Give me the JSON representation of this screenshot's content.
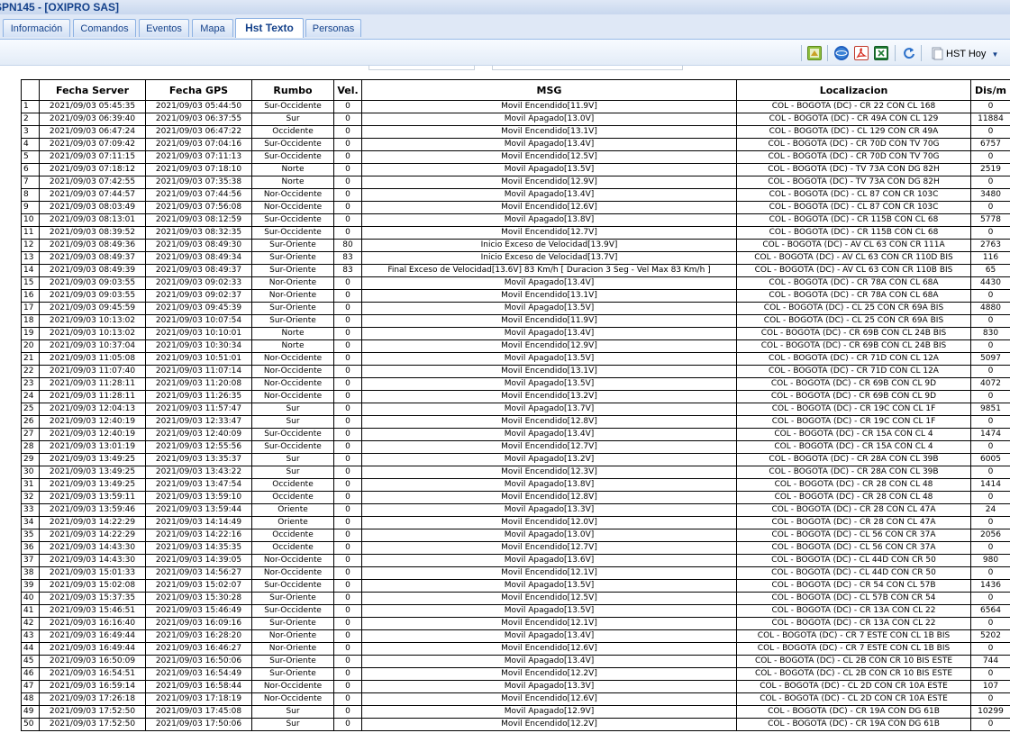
{
  "window": {
    "title": "SPN145 - [OXIPRO SAS]"
  },
  "tabs": [
    {
      "label": "Información",
      "active": false
    },
    {
      "label": "Comandos",
      "active": false
    },
    {
      "label": "Eventos",
      "active": false
    },
    {
      "label": "Mapa",
      "active": false
    },
    {
      "label": "Hst Texto",
      "active": true
    },
    {
      "label": "Personas",
      "active": false
    }
  ],
  "toolbar": {
    "icons": [
      "map-export-icon",
      "globe-icon",
      "pdf-icon",
      "excel-icon",
      "refresh-icon",
      "document-icon"
    ],
    "hst_label": "HST Hoy",
    "hst_dropdown_icon": "chevron-down-icon"
  },
  "table": {
    "columns": [
      "",
      "Fecha Server",
      "Fecha GPS",
      "Rumbo",
      "Vel.",
      "MSG",
      "Localizacion",
      "Dis/m"
    ],
    "rows": [
      [
        "1",
        "2021/09/03 05:45:35",
        "2021/09/03 05:44:50",
        "Sur-Occidente",
        "0",
        "Movil Encendido[11.9V]",
        "COL - BOGOTA (DC) - CR 22 CON CL 168",
        "0"
      ],
      [
        "2",
        "2021/09/03 06:39:40",
        "2021/09/03 06:37:55",
        "Sur",
        "0",
        "Movil Apagado[13.0V]",
        "COL - BOGOTA (DC) - CR 49A CON CL 129",
        "11884"
      ],
      [
        "3",
        "2021/09/03 06:47:24",
        "2021/09/03 06:47:22",
        "Occidente",
        "0",
        "Movil Encendido[13.1V]",
        "COL - BOGOTA (DC) - CL 129 CON CR 49A",
        "0"
      ],
      [
        "4",
        "2021/09/03 07:09:42",
        "2021/09/03 07:04:16",
        "Sur-Occidente",
        "0",
        "Movil Apagado[13.4V]",
        "COL - BOGOTA (DC) - CR 70D CON TV 70G",
        "6757"
      ],
      [
        "5",
        "2021/09/03 07:11:15",
        "2021/09/03 07:11:13",
        "Sur-Occidente",
        "0",
        "Movil Encendido[12.5V]",
        "COL - BOGOTA (DC) - CR 70D CON TV 70G",
        "0"
      ],
      [
        "6",
        "2021/09/03 07:18:12",
        "2021/09/03 07:18:10",
        "Norte",
        "0",
        "Movil Apagado[13.5V]",
        "COL - BOGOTA (DC) - TV 73A CON DG 82H",
        "2519"
      ],
      [
        "7",
        "2021/09/03 07:42:55",
        "2021/09/03 07:35:38",
        "Norte",
        "0",
        "Movil Encendido[12.9V]",
        "COL - BOGOTA (DC) - TV 73A CON DG 82H",
        "0"
      ],
      [
        "8",
        "2021/09/03 07:44:57",
        "2021/09/03 07:44:56",
        "Nor-Occidente",
        "0",
        "Movil Apagado[13.4V]",
        "COL - BOGOTA (DC) - CL 87 CON CR 103C",
        "3480"
      ],
      [
        "9",
        "2021/09/03 08:03:49",
        "2021/09/03 07:56:08",
        "Nor-Occidente",
        "0",
        "Movil Encendido[12.6V]",
        "COL - BOGOTA (DC) - CL 87 CON CR 103C",
        "0"
      ],
      [
        "10",
        "2021/09/03 08:13:01",
        "2021/09/03 08:12:59",
        "Sur-Occidente",
        "0",
        "Movil Apagado[13.8V]",
        "COL - BOGOTA (DC) - CR 115B CON CL 68",
        "5778"
      ],
      [
        "11",
        "2021/09/03 08:39:52",
        "2021/09/03 08:32:35",
        "Sur-Occidente",
        "0",
        "Movil Encendido[12.7V]",
        "COL - BOGOTA (DC) - CR 115B CON CL 68",
        "0"
      ],
      [
        "12",
        "2021/09/03 08:49:36",
        "2021/09/03 08:49:30",
        "Sur-Oriente",
        "80",
        "Inicio Exceso de Velocidad[13.9V]",
        "COL - BOGOTA (DC) - AV CL 63 CON CR 111A",
        "2763"
      ],
      [
        "13",
        "2021/09/03 08:49:37",
        "2021/09/03 08:49:34",
        "Sur-Oriente",
        "83",
        "Inicio Exceso de Velocidad[13.7V]",
        "COL - BOGOTA (DC) - AV CL 63 CON CR 110D BIS",
        "116"
      ],
      [
        "14",
        "2021/09/03 08:49:39",
        "2021/09/03 08:49:37",
        "Sur-Oriente",
        "83",
        "Final Exceso de Velocidad[13.6V] 83 Km/h [ Duracion 3 Seg - Vel Max 83 Km/h ]",
        "COL - BOGOTA (DC) - AV CL 63 CON CR 110B BIS",
        "65"
      ],
      [
        "15",
        "2021/09/03 09:03:55",
        "2021/09/03 09:02:33",
        "Nor-Oriente",
        "0",
        "Movil Apagado[13.4V]",
        "COL - BOGOTA (DC) - CR 78A CON CL 68A",
        "4430"
      ],
      [
        "16",
        "2021/09/03 09:03:55",
        "2021/09/03 09:02:37",
        "Nor-Oriente",
        "0",
        "Movil Encendido[13.1V]",
        "COL - BOGOTA (DC) - CR 78A CON CL 68A",
        "0"
      ],
      [
        "17",
        "2021/09/03 09:45:59",
        "2021/09/03 09:45:39",
        "Sur-Oriente",
        "0",
        "Movil Apagado[13.5V]",
        "COL - BOGOTA (DC) - CL 25 CON CR 69A BIS",
        "4880"
      ],
      [
        "18",
        "2021/09/03 10:13:02",
        "2021/09/03 10:07:54",
        "Sur-Oriente",
        "0",
        "Movil Encendido[11.9V]",
        "COL - BOGOTA (DC) - CL 25 CON CR 69A BIS",
        "0"
      ],
      [
        "19",
        "2021/09/03 10:13:02",
        "2021/09/03 10:10:01",
        "Norte",
        "0",
        "Movil Apagado[13.4V]",
        "COL - BOGOTA (DC) - CR 69B CON CL 24B BIS",
        "830"
      ],
      [
        "20",
        "2021/09/03 10:37:04",
        "2021/09/03 10:30:34",
        "Norte",
        "0",
        "Movil Encendido[12.9V]",
        "COL - BOGOTA (DC) - CR 69B CON CL 24B BIS",
        "0"
      ],
      [
        "21",
        "2021/09/03 11:05:08",
        "2021/09/03 10:51:01",
        "Nor-Occidente",
        "0",
        "Movil Apagado[13.5V]",
        "COL - BOGOTA (DC) - CR 71D CON CL 12A",
        "5097"
      ],
      [
        "22",
        "2021/09/03 11:07:40",
        "2021/09/03 11:07:14",
        "Nor-Occidente",
        "0",
        "Movil Encendido[13.1V]",
        "COL - BOGOTA (DC) - CR 71D CON CL 12A",
        "0"
      ],
      [
        "23",
        "2021/09/03 11:28:11",
        "2021/09/03 11:20:08",
        "Nor-Occidente",
        "0",
        "Movil Apagado[13.5V]",
        "COL - BOGOTA (DC) - CR 69B CON CL 9D",
        "4072"
      ],
      [
        "24",
        "2021/09/03 11:28:11",
        "2021/09/03 11:26:35",
        "Nor-Occidente",
        "0",
        "Movil Encendido[13.2V]",
        "COL - BOGOTA (DC) - CR 69B CON CL 9D",
        "0"
      ],
      [
        "25",
        "2021/09/03 12:04:13",
        "2021/09/03 11:57:47",
        "Sur",
        "0",
        "Movil Apagado[13.7V]",
        "COL - BOGOTA (DC) - CR 19C CON CL 1F",
        "9851"
      ],
      [
        "26",
        "2021/09/03 12:40:19",
        "2021/09/03 12:33:47",
        "Sur",
        "0",
        "Movil Encendido[12.8V]",
        "COL - BOGOTA (DC) - CR 19C CON CL 1F",
        "0"
      ],
      [
        "27",
        "2021/09/03 12:40:19",
        "2021/09/03 12:40:09",
        "Sur-Occidente",
        "0",
        "Movil Apagado[13.4V]",
        "COL - BOGOTA (DC) - CR 15A CON CL 4",
        "1474"
      ],
      [
        "28",
        "2021/09/03 13:01:19",
        "2021/09/03 12:55:56",
        "Sur-Occidente",
        "0",
        "Movil Encendido[12.7V]",
        "COL - BOGOTA (DC) - CR 15A CON CL 4",
        "0"
      ],
      [
        "29",
        "2021/09/03 13:49:25",
        "2021/09/03 13:35:37",
        "Sur",
        "0",
        "Movil Apagado[13.2V]",
        "COL - BOGOTA (DC) - CR 28A CON CL 39B",
        "6005"
      ],
      [
        "30",
        "2021/09/03 13:49:25",
        "2021/09/03 13:43:22",
        "Sur",
        "0",
        "Movil Encendido[12.3V]",
        "COL - BOGOTA (DC) - CR 28A CON CL 39B",
        "0"
      ],
      [
        "31",
        "2021/09/03 13:49:25",
        "2021/09/03 13:47:54",
        "Occidente",
        "0",
        "Movil Apagado[13.8V]",
        "COL - BOGOTA (DC) - CR 28 CON CL 48",
        "1414"
      ],
      [
        "32",
        "2021/09/03 13:59:11",
        "2021/09/03 13:59:10",
        "Occidente",
        "0",
        "Movil Encendido[12.8V]",
        "COL - BOGOTA (DC) - CR 28 CON CL 48",
        "0"
      ],
      [
        "33",
        "2021/09/03 13:59:46",
        "2021/09/03 13:59:44",
        "Oriente",
        "0",
        "Movil Apagado[13.3V]",
        "COL - BOGOTA (DC) - CR 28 CON CL 47A",
        "24"
      ],
      [
        "34",
        "2021/09/03 14:22:29",
        "2021/09/03 14:14:49",
        "Oriente",
        "0",
        "Movil Encendido[12.0V]",
        "COL - BOGOTA (DC) - CR 28 CON CL 47A",
        "0"
      ],
      [
        "35",
        "2021/09/03 14:22:29",
        "2021/09/03 14:22:16",
        "Occidente",
        "0",
        "Movil Apagado[13.0V]",
        "COL - BOGOTA (DC) - CL 56 CON CR 37A",
        "2056"
      ],
      [
        "36",
        "2021/09/03 14:43:30",
        "2021/09/03 14:35:35",
        "Occidente",
        "0",
        "Movil Encendido[12.7V]",
        "COL - BOGOTA (DC) - CL 56 CON CR 37A",
        "0"
      ],
      [
        "37",
        "2021/09/03 14:43:30",
        "2021/09/03 14:39:05",
        "Nor-Occidente",
        "0",
        "Movil Apagado[13.6V]",
        "COL - BOGOTA (DC) - CL 44D CON CR 50",
        "980"
      ],
      [
        "38",
        "2021/09/03 15:01:33",
        "2021/09/03 14:56:27",
        "Nor-Occidente",
        "0",
        "Movil Encendido[12.1V]",
        "COL - BOGOTA (DC) - CL 44D CON CR 50",
        "0"
      ],
      [
        "39",
        "2021/09/03 15:02:08",
        "2021/09/03 15:02:07",
        "Sur-Occidente",
        "0",
        "Movil Apagado[13.5V]",
        "COL - BOGOTA (DC) - CR 54 CON CL 57B",
        "1436"
      ],
      [
        "40",
        "2021/09/03 15:37:35",
        "2021/09/03 15:30:28",
        "Sur-Oriente",
        "0",
        "Movil Encendido[12.5V]",
        "COL - BOGOTA (DC) - CL 57B CON CR 54",
        "0"
      ],
      [
        "41",
        "2021/09/03 15:46:51",
        "2021/09/03 15:46:49",
        "Sur-Occidente",
        "0",
        "Movil Apagado[13.5V]",
        "COL - BOGOTA (DC) - CR 13A CON CL 22",
        "6564"
      ],
      [
        "42",
        "2021/09/03 16:16:40",
        "2021/09/03 16:09:16",
        "Sur-Oriente",
        "0",
        "Movil Encendido[12.1V]",
        "COL - BOGOTA (DC) - CR 13A CON CL 22",
        "0"
      ],
      [
        "43",
        "2021/09/03 16:49:44",
        "2021/09/03 16:28:20",
        "Nor-Oriente",
        "0",
        "Movil Apagado[13.4V]",
        "COL - BOGOTA (DC) - CR 7 ESTE CON CL 1B BIS",
        "5202"
      ],
      [
        "44",
        "2021/09/03 16:49:44",
        "2021/09/03 16:46:27",
        "Nor-Oriente",
        "0",
        "Movil Encendido[12.6V]",
        "COL - BOGOTA (DC) - CR 7 ESTE CON CL 1B BIS",
        "0"
      ],
      [
        "45",
        "2021/09/03 16:50:09",
        "2021/09/03 16:50:06",
        "Sur-Oriente",
        "0",
        "Movil Apagado[13.4V]",
        "COL - BOGOTA (DC) - CL 2B CON CR 10 BIS ESTE",
        "744"
      ],
      [
        "46",
        "2021/09/03 16:54:51",
        "2021/09/03 16:54:49",
        "Sur-Oriente",
        "0",
        "Movil Encendido[12.2V]",
        "COL - BOGOTA (DC) - CL 2B CON CR 10 BIS ESTE",
        "0"
      ],
      [
        "47",
        "2021/09/03 16:59:14",
        "2021/09/03 16:58:44",
        "Nor-Occidente",
        "0",
        "Movil Apagado[13.3V]",
        "COL - BOGOTA (DC) - CL 2D CON CR 10A ESTE",
        "107"
      ],
      [
        "48",
        "2021/09/03 17:26:18",
        "2021/09/03 17:18:19",
        "Nor-Occidente",
        "0",
        "Movil Encendido[12.6V]",
        "COL - BOGOTA (DC) - CL 2D CON CR 10A ESTE",
        "0"
      ],
      [
        "49",
        "2021/09/03 17:52:50",
        "2021/09/03 17:45:08",
        "Sur",
        "0",
        "Movil Apagado[12.9V]",
        "COL - BOGOTA (DC) - CR 19A CON DG 61B",
        "10299"
      ],
      [
        "50",
        "2021/09/03 17:52:50",
        "2021/09/03 17:50:06",
        "Sur",
        "0",
        "Movil Encendido[12.2V]",
        "COL - BOGOTA (DC) - CR 19A CON DG 61B",
        "0"
      ]
    ]
  }
}
